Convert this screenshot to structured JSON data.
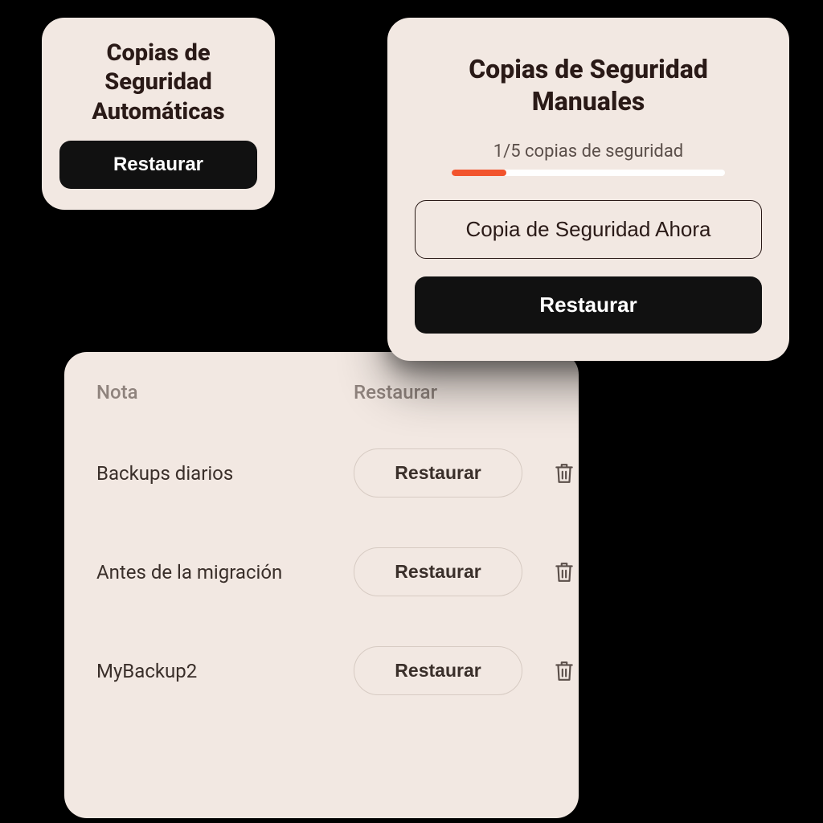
{
  "auto": {
    "title": "Copias de Seguridad Automáticas",
    "restore_label": "Restaurar"
  },
  "manual": {
    "title": "Copias de Seguridad Manuales",
    "count_label": "1/5 copias de seguridad",
    "progress_percent": 20,
    "backup_now_label": "Copia de Seguridad Ahora",
    "restore_label": "Restaurar"
  },
  "list": {
    "header_note": "Nota",
    "header_restore": "Restaurar",
    "restore_button_label": "Restaurar",
    "rows": [
      {
        "note": "Backups diarios"
      },
      {
        "note": "Antes de la migración"
      },
      {
        "note": "MyBackup2"
      }
    ]
  }
}
